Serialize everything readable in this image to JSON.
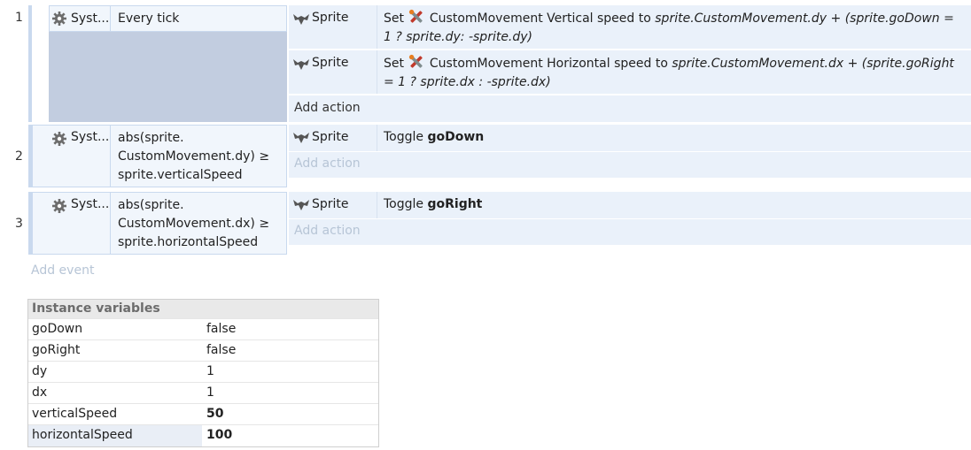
{
  "events": [
    {
      "number": "1",
      "condition": {
        "object": "Syst...",
        "text_lines": [
          "Every tick"
        ]
      },
      "actions": [
        {
          "object": "Sprite",
          "prefix": "Set",
          "behavior": "CustomMovement Vertical speed to",
          "expr_line1": "sprite.CustomMovement.dy + (sprite.goDown =",
          "expr_line2": "1 ? sprite.dy: -sprite.dy)"
        },
        {
          "object": "Sprite",
          "prefix": "Set",
          "behavior": "CustomMovement Horizontal speed to",
          "expr_line1": "sprite.CustomMovement.dx + (sprite.goRight",
          "expr_line2": "= 1 ? sprite.dx : -sprite.dx)"
        }
      ],
      "add_action": "Add action"
    },
    {
      "number": "2",
      "condition": {
        "object": "Syst...",
        "text_lines": [
          "abs(sprite.",
          "CustomMovement.dy) ≥",
          "sprite.verticalSpeed"
        ]
      },
      "actions": [
        {
          "object": "Sprite",
          "prefix": "Toggle",
          "bold": "goDown"
        }
      ],
      "add_action": "Add action"
    },
    {
      "number": "3",
      "condition": {
        "object": "Syst...",
        "text_lines": [
          "abs(sprite.",
          "CustomMovement.dx) ≥",
          "sprite.horizontalSpeed"
        ]
      },
      "actions": [
        {
          "object": "Sprite",
          "prefix": "Toggle",
          "bold": "goRight"
        }
      ],
      "add_action": "Add action"
    }
  ],
  "add_event": "Add event",
  "instance_variables": {
    "header": "Instance variables",
    "rows": [
      {
        "name": "goDown",
        "value": "false"
      },
      {
        "name": "goRight",
        "value": "false"
      },
      {
        "name": "dy",
        "value": "1"
      },
      {
        "name": "dx",
        "value": "1"
      },
      {
        "name": "verticalSpeed",
        "value": "50"
      },
      {
        "name": "horizontalSpeed",
        "value": "100"
      }
    ]
  },
  "icons": {
    "system": "gear-icon",
    "sprite": "sprite-icon",
    "behavior": "tools-icon"
  },
  "colors": {
    "condition_bg": "#f1f6fc",
    "action_bg": "#eaf1fa",
    "selected_block": "#c2cde0",
    "faint_text": "#b7c5d6"
  }
}
